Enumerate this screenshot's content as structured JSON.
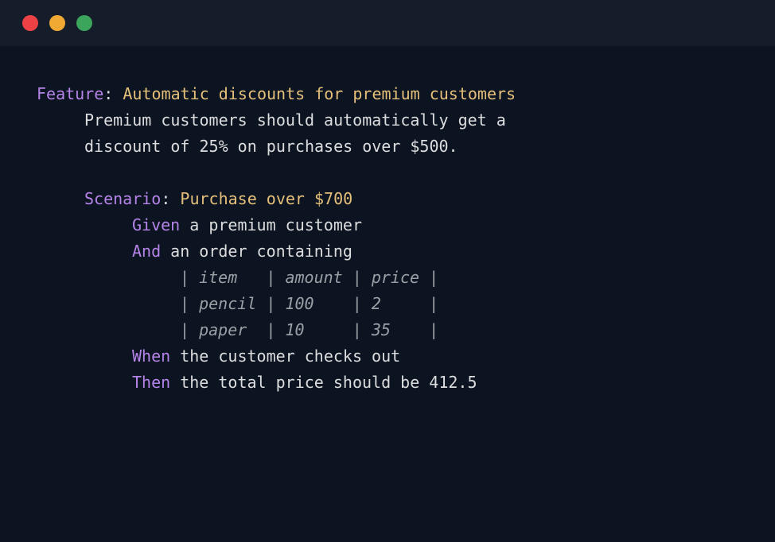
{
  "titlebar": {
    "red": "close",
    "yellow": "minimize",
    "green": "maximize"
  },
  "code": {
    "feature_kw": "Feature",
    "feature_title": "Automatic discounts for premium customers",
    "desc_line1": "Premium customers should automatically get a",
    "desc_line2": "discount of 25% on purchases over $500.",
    "scenario_kw": "Scenario",
    "scenario_title": "Purchase over $700",
    "given_kw": "Given",
    "given_txt": "a premium customer",
    "and_kw": "And",
    "and_txt": "an order containing",
    "table_row1": "| item   | amount | price |",
    "table_row2": "| pencil | 100    | 2     |",
    "table_row3": "| paper  | 10     | 35    |",
    "when_kw": "When",
    "when_txt": "the customer checks out",
    "then_kw": "Then",
    "then_txt": "the total price should be 412.5"
  }
}
